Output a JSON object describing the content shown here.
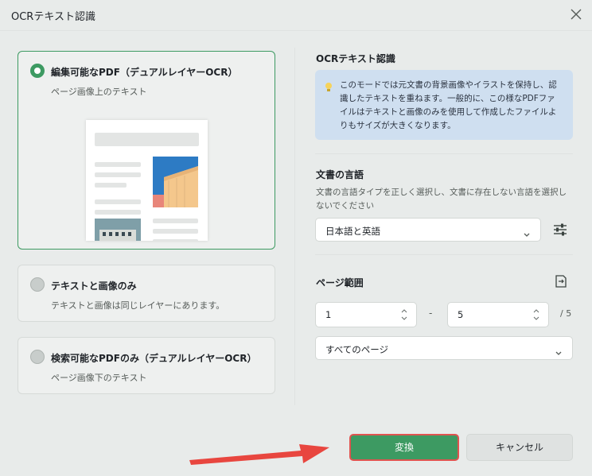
{
  "dialog": {
    "title": "OCRテキスト認識"
  },
  "modes": [
    {
      "title": "編集可能なPDF（デュアルレイヤーOCR）",
      "subtitle": "ページ画像上のテキスト",
      "selected": true
    },
    {
      "title": "テキストと画像のみ",
      "subtitle": "テキストと画像は同じレイヤーにあります。",
      "selected": false
    },
    {
      "title": "検索可能なPDFのみ（デュアルレイヤーOCR）",
      "subtitle": "ページ画像下のテキスト",
      "selected": false
    }
  ],
  "ocr_section": {
    "label": "OCRテキスト認識",
    "info": "このモードでは元文書の背景画像やイラストを保持し、認識したテキストを重ねます。一般的に、この様なPDFファイルはテキストと画像のみを使用して作成したファイルよりもサイズが大きくなります。"
  },
  "language": {
    "label": "文書の言語",
    "description": "文書の言語タイプを正しく選択し、文書に存在しない言語を選択しないでください",
    "selected": "日本語と英語"
  },
  "page_range": {
    "label": "ページ範囲",
    "from": "1",
    "separator": "-",
    "to": "5",
    "total": "/ 5",
    "scope": "すべてのページ"
  },
  "buttons": {
    "convert": "変換",
    "cancel": "キャンセル"
  },
  "colors": {
    "accent": "#3d9a62",
    "highlight_border": "#e0534f",
    "info_background": "#cfdff0"
  }
}
